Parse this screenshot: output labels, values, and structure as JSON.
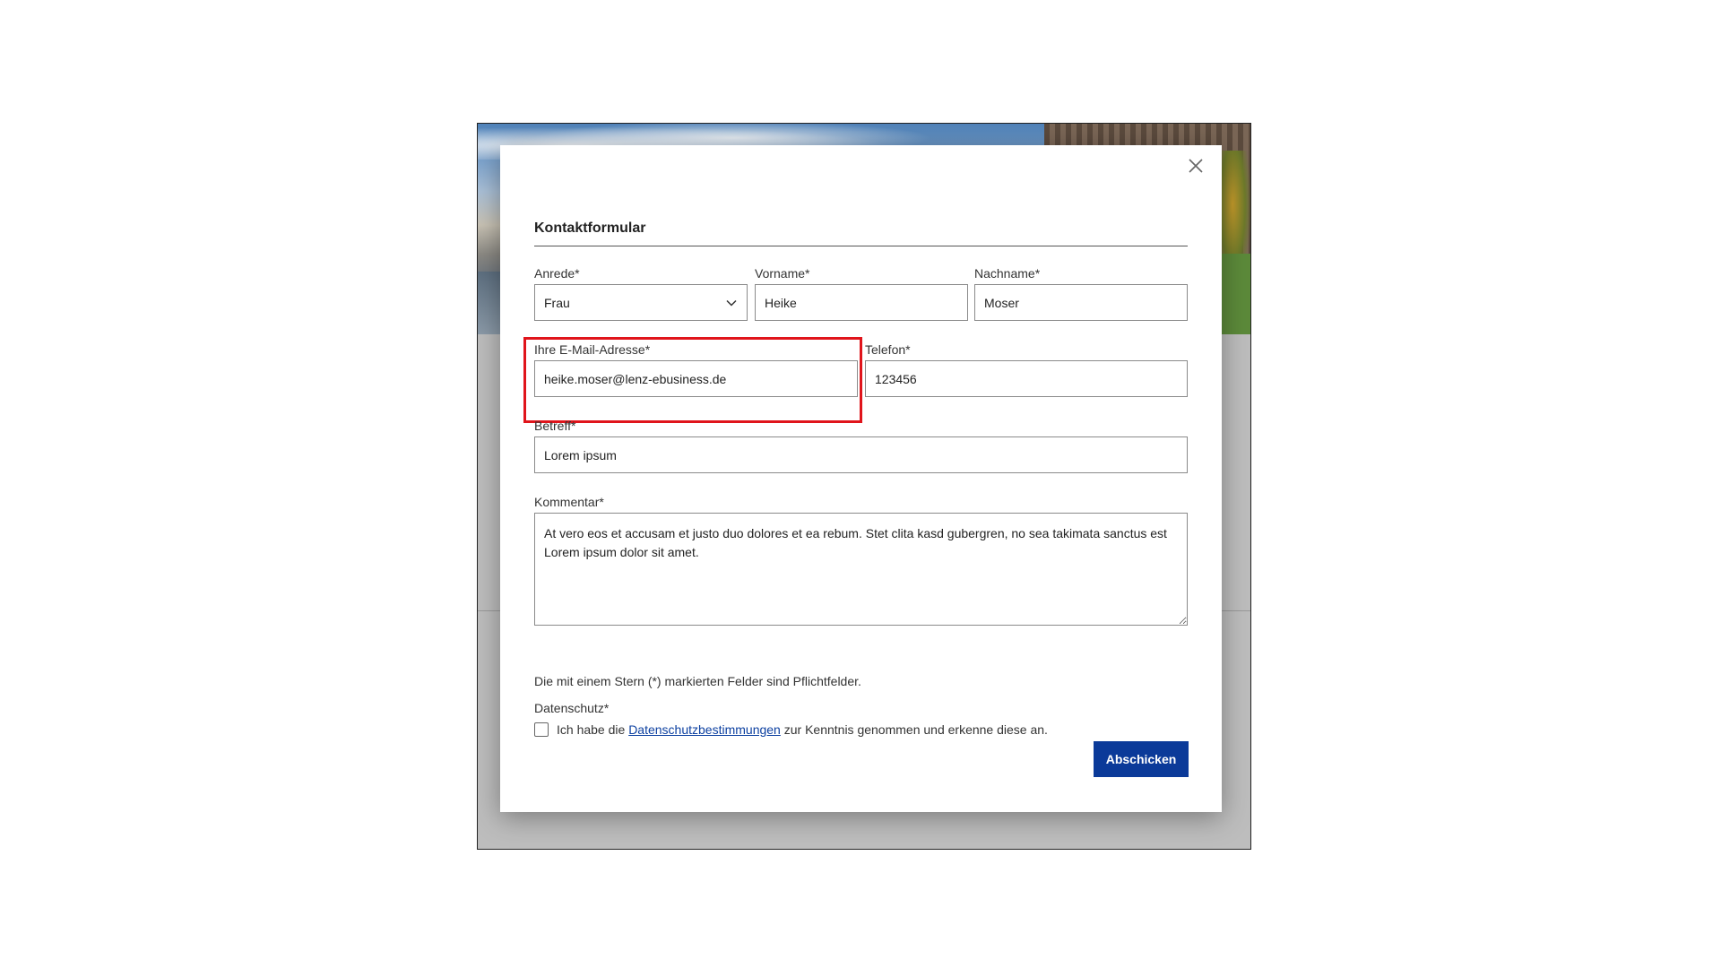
{
  "form": {
    "title": "Kontaktformular",
    "close_label": "close",
    "fields": {
      "salutation": {
        "label": "Anrede*",
        "value": "Frau"
      },
      "firstname": {
        "label": "Vorname*",
        "value": "Heike"
      },
      "lastname": {
        "label": "Nachname*",
        "value": "Moser"
      },
      "email": {
        "label": "Ihre E-Mail-Adresse*",
        "value": "heike.moser@lenz-ebusiness.de"
      },
      "phone": {
        "label": "Telefon*",
        "value": "123456"
      },
      "subject": {
        "label": "Betreff*",
        "value": "Lorem ipsum"
      },
      "comment": {
        "label": "Kommentar*",
        "value": "At vero eos et accusam et justo duo dolores et ea rebum. Stet clita kasd gubergren, no sea takimata sanctus est Lorem ipsum dolor sit amet."
      }
    },
    "required_note": "Die mit einem Stern (*) markierten Felder sind Pflichtfelder.",
    "privacy": {
      "label": "Datenschutz*",
      "text_before": "Ich habe die",
      "link_text": "Datenschutzbestimmungen",
      "text_after": "zur Kenntnis genommen und erkenne diese an.",
      "checked": false
    },
    "submit_label": "Abschicken"
  },
  "colors": {
    "submit_bg": "#0b3a99",
    "link": "#0b3fa0",
    "highlight": "#e0141b"
  },
  "icons": {
    "close": "close-icon",
    "select": "chevron-down-icon"
  }
}
